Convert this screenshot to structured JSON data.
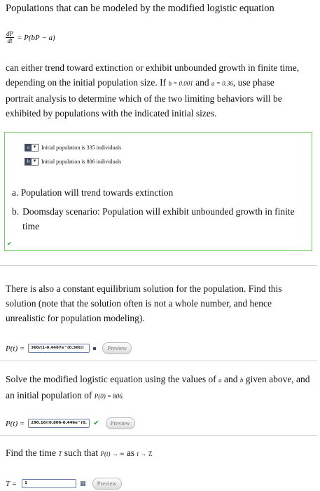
{
  "title": "Populations that can be modeled by the modified logistic equation",
  "equation": {
    "numerator": "dP",
    "denominator": "dt",
    "rhs": "= P(bP − a)"
  },
  "intro": {
    "text1": "can either trend toward extinction or exhibit unbounded growth in finite time, depending on the initial population size. If",
    "b_label": "b = 0.001",
    "and": "and",
    "a_label": "a = 0.36",
    "text2": ", use phase portrait analysis to determine which of the two limiting behaviors will be exhibited by populations with the indicated initial sizes."
  },
  "matching": {
    "rows": [
      {
        "letter": "a",
        "text": "Initial population is 335 individuals"
      },
      {
        "letter": "b",
        "text": "Initial population is 806 individuals"
      }
    ],
    "options": [
      {
        "label": "a.",
        "text": "Population will trend towards extinction"
      },
      {
        "label": "b.",
        "text": "Doomsday scenario: Population will exhibit unbounded growth in finite time"
      }
    ],
    "status_icon": "check-icon"
  },
  "q1": {
    "text": "There is also a constant equilibrium solution for the population. Find this solution (note that the solution often is not a whole number, and hence unrealistic for population modeling).",
    "label": "P(t) =",
    "answer": "360/(1-0.4467e^(0.36t))",
    "preview": "Preview"
  },
  "q2": {
    "text1": "Solve the modified logistic equation using the values of",
    "a": "a",
    "and": "and",
    "b": "b",
    "text2": "given above, and an initial population of",
    "init": "P(0) = 806.",
    "label": "P(t) =",
    "answer": "290.16/(0.806-0.446e^(0.",
    "preview": "Preview"
  },
  "q3": {
    "text1": "Find the time",
    "T": "T",
    "text2": "such that",
    "cond": "P(t) → ∞",
    "as": "as",
    "limit": "t → T.",
    "label": "T =",
    "answer": "1",
    "preview": "Preview"
  },
  "colors": {
    "correct": "#2e9a2e",
    "box_border": "#6fcf5f",
    "input_border": "#6b7fa8"
  }
}
